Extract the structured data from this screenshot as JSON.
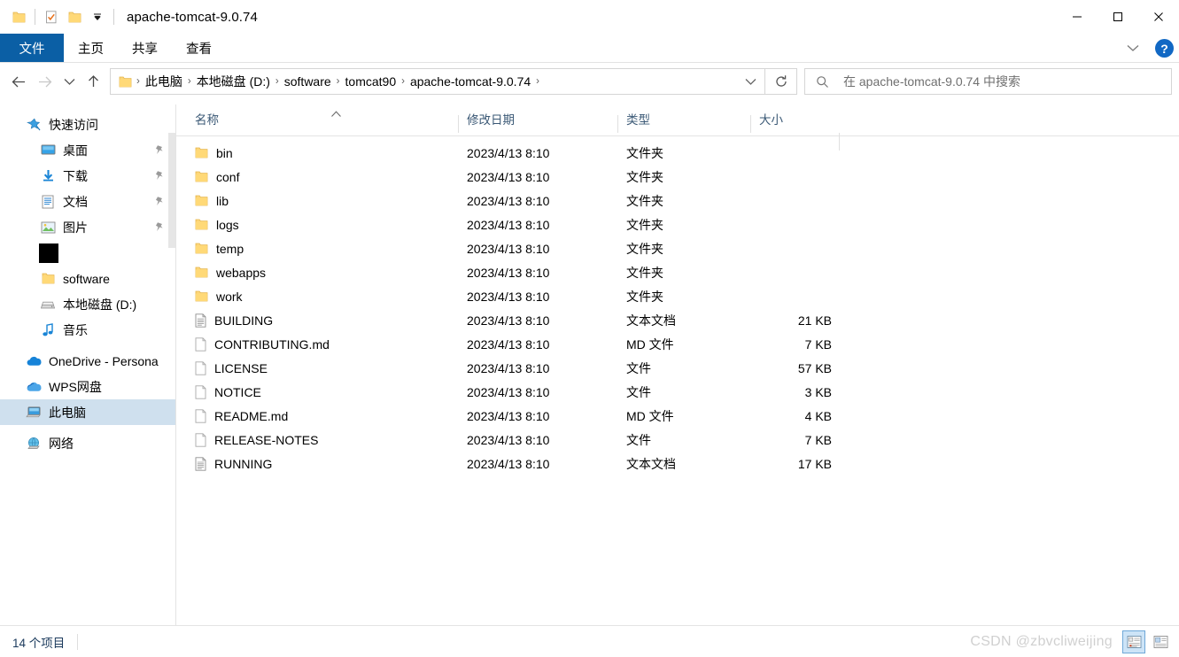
{
  "window": {
    "title": "apache-tomcat-9.0.74",
    "quick_access": [
      {
        "name": "folder-icon",
        "label": ""
      },
      {
        "name": "properties-icon",
        "label": ""
      },
      {
        "name": "new-folder-icon",
        "label": ""
      },
      {
        "name": "customize-dropdown-icon",
        "label": "▾"
      }
    ],
    "controls": {
      "minimize": "—",
      "maximize": "▢",
      "close": "✕"
    }
  },
  "ribbon": {
    "tabs": [
      {
        "label": "文件",
        "active": true
      },
      {
        "label": "主页",
        "active": false
      },
      {
        "label": "共享",
        "active": false
      },
      {
        "label": "查看",
        "active": false
      }
    ],
    "collapse_label": "⌄",
    "help_label": "?",
    "accent_color": "#0b5fa5"
  },
  "addressbar": {
    "back_label": "←",
    "forward_label": "→",
    "recent_label": "⌄",
    "up_label": "↑",
    "crumbs": [
      "此电脑",
      "本地磁盘 (D:)",
      "software",
      "tomcat90",
      "apache-tomcat-9.0.74"
    ],
    "separator": "›",
    "dropdown_label": "⌄",
    "refresh_label": "↻"
  },
  "search": {
    "placeholder": "在 apache-tomcat-9.0.74 中搜索",
    "icon": "search-icon"
  },
  "sidebar": {
    "items": [
      {
        "label": "快速访问",
        "icon": "star-pin-icon",
        "indent": 0,
        "pinned": false,
        "selected": false
      },
      {
        "label": "桌面",
        "icon": "desktop-icon",
        "indent": 1,
        "pinned": true,
        "selected": false
      },
      {
        "label": "下载",
        "icon": "download-icon",
        "indent": 1,
        "pinned": true,
        "selected": false
      },
      {
        "label": "文档",
        "icon": "documents-icon",
        "indent": 1,
        "pinned": true,
        "selected": false
      },
      {
        "label": "图片",
        "icon": "pictures-icon",
        "indent": 1,
        "pinned": true,
        "selected": false
      },
      {
        "label": "",
        "icon": "redacted-icon",
        "indent": 1,
        "pinned": false,
        "selected": false
      },
      {
        "label": "software",
        "icon": "folder-icon",
        "indent": 1,
        "pinned": false,
        "selected": false
      },
      {
        "label": "本地磁盘 (D:)",
        "icon": "drive-icon",
        "indent": 1,
        "pinned": false,
        "selected": false
      },
      {
        "label": "音乐",
        "icon": "music-icon",
        "indent": 1,
        "pinned": false,
        "selected": false
      },
      {
        "label": "OneDrive - Persona",
        "icon": "onedrive-icon",
        "indent": 0,
        "pinned": false,
        "selected": false
      },
      {
        "label": "WPS网盘",
        "icon": "wps-cloud-icon",
        "indent": 0,
        "pinned": false,
        "selected": false
      },
      {
        "label": "此电脑",
        "icon": "this-pc-icon",
        "indent": 0,
        "pinned": false,
        "selected": true
      },
      {
        "label": "网络",
        "icon": "network-icon",
        "indent": 0,
        "pinned": false,
        "selected": false
      }
    ]
  },
  "filelist": {
    "columns": [
      {
        "label": "名称",
        "sorted": "asc"
      },
      {
        "label": "修改日期",
        "sorted": ""
      },
      {
        "label": "类型",
        "sorted": ""
      },
      {
        "label": "大小",
        "sorted": ""
      }
    ],
    "sort_caret": "⌃",
    "rows": [
      {
        "name": "bin",
        "date": "2023/4/13 8:10",
        "type": "文件夹",
        "size": "",
        "icon": "folder-icon"
      },
      {
        "name": "conf",
        "date": "2023/4/13 8:10",
        "type": "文件夹",
        "size": "",
        "icon": "folder-icon"
      },
      {
        "name": "lib",
        "date": "2023/4/13 8:10",
        "type": "文件夹",
        "size": "",
        "icon": "folder-icon"
      },
      {
        "name": "logs",
        "date": "2023/4/13 8:10",
        "type": "文件夹",
        "size": "",
        "icon": "folder-icon"
      },
      {
        "name": "temp",
        "date": "2023/4/13 8:10",
        "type": "文件夹",
        "size": "",
        "icon": "folder-icon"
      },
      {
        "name": "webapps",
        "date": "2023/4/13 8:10",
        "type": "文件夹",
        "size": "",
        "icon": "folder-icon"
      },
      {
        "name": "work",
        "date": "2023/4/13 8:10",
        "type": "文件夹",
        "size": "",
        "icon": "folder-icon"
      },
      {
        "name": "BUILDING",
        "date": "2023/4/13 8:10",
        "type": "文本文档",
        "size": "21 KB",
        "icon": "text-file-icon"
      },
      {
        "name": "CONTRIBUTING.md",
        "date": "2023/4/13 8:10",
        "type": "MD 文件",
        "size": "7 KB",
        "icon": "blank-file-icon"
      },
      {
        "name": "LICENSE",
        "date": "2023/4/13 8:10",
        "type": "文件",
        "size": "57 KB",
        "icon": "blank-file-icon"
      },
      {
        "name": "NOTICE",
        "date": "2023/4/13 8:10",
        "type": "文件",
        "size": "3 KB",
        "icon": "blank-file-icon"
      },
      {
        "name": "README.md",
        "date": "2023/4/13 8:10",
        "type": "MD 文件",
        "size": "4 KB",
        "icon": "blank-file-icon"
      },
      {
        "name": "RELEASE-NOTES",
        "date": "2023/4/13 8:10",
        "type": "文件",
        "size": "7 KB",
        "icon": "blank-file-icon"
      },
      {
        "name": "RUNNING",
        "date": "2023/4/13 8:10",
        "type": "文本文档",
        "size": "17 KB",
        "icon": "text-file-icon"
      }
    ]
  },
  "statusbar": {
    "item_count": "14 个项目",
    "watermark": "CSDN @zbvcliweijing",
    "views": [
      {
        "name": "details-view-button",
        "active": true
      },
      {
        "name": "large-icons-view-button",
        "active": false
      }
    ]
  }
}
